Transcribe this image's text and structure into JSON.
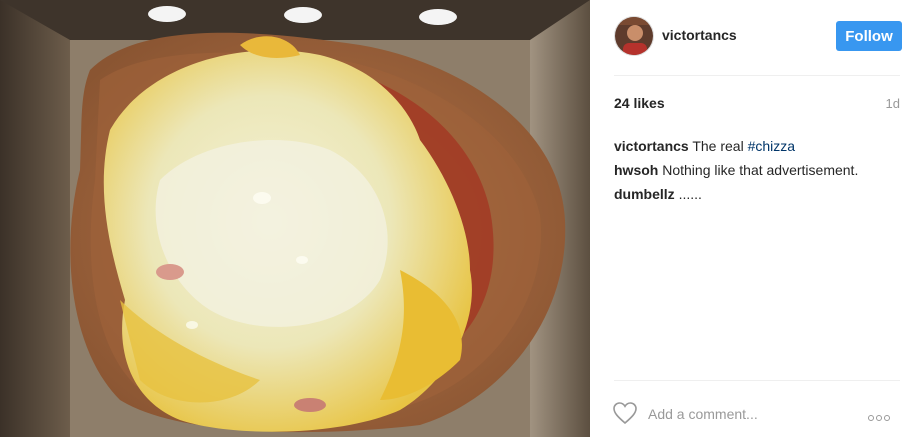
{
  "post": {
    "image_alt": "",
    "author": {
      "username": "victortancs",
      "avatar_icon": "user-avatar-icon"
    },
    "follow_label": "Follow",
    "likes": "24 likes",
    "time": "1d"
  },
  "comments": [
    {
      "author": "victortancs",
      "text": "The real ",
      "hashtag": "#chizza"
    },
    {
      "author": "hwsoh",
      "text": "Nothing like that advertisement.",
      "hashtag": ""
    },
    {
      "author": "dumbellz",
      "text": "......",
      "hashtag": ""
    }
  ],
  "footer": {
    "like_icon": "heart-icon",
    "comment_placeholder": "Add a comment...",
    "more_icon": "more-options-icon"
  },
  "colors": {
    "follow_button": "#3897f0",
    "hashtag": "#003569",
    "muted": "#999999"
  }
}
